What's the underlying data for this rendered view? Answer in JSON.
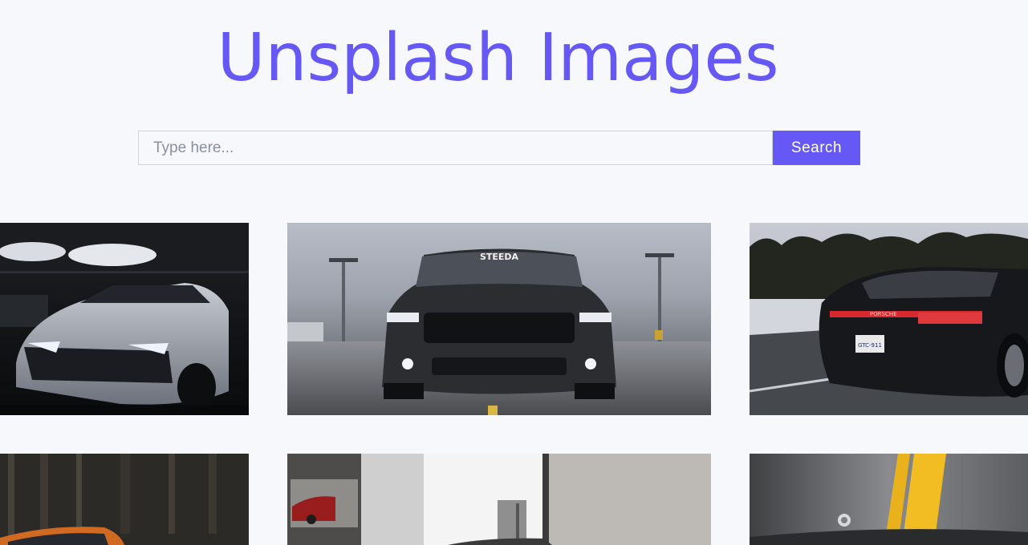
{
  "header": {
    "title": "Unsplash Images"
  },
  "search": {
    "placeholder": "Type here...",
    "value": "",
    "button_label": "Search"
  },
  "gallery": {
    "images": [
      {
        "subject": "white Camaro in dark garage"
      },
      {
        "subject": "black Mustang front view"
      },
      {
        "subject": "black Porsche rear view on highway"
      },
      {
        "subject": "orange car in forest"
      },
      {
        "subject": "car in white showroom"
      },
      {
        "subject": "grey car with yellow stripe"
      }
    ],
    "plate_text": "GTC-911",
    "windshield_banner": "STEEDA",
    "rear_badge": "PORSCHE"
  },
  "colors": {
    "accent": "#6558f5",
    "background": "#f7f8fb"
  }
}
